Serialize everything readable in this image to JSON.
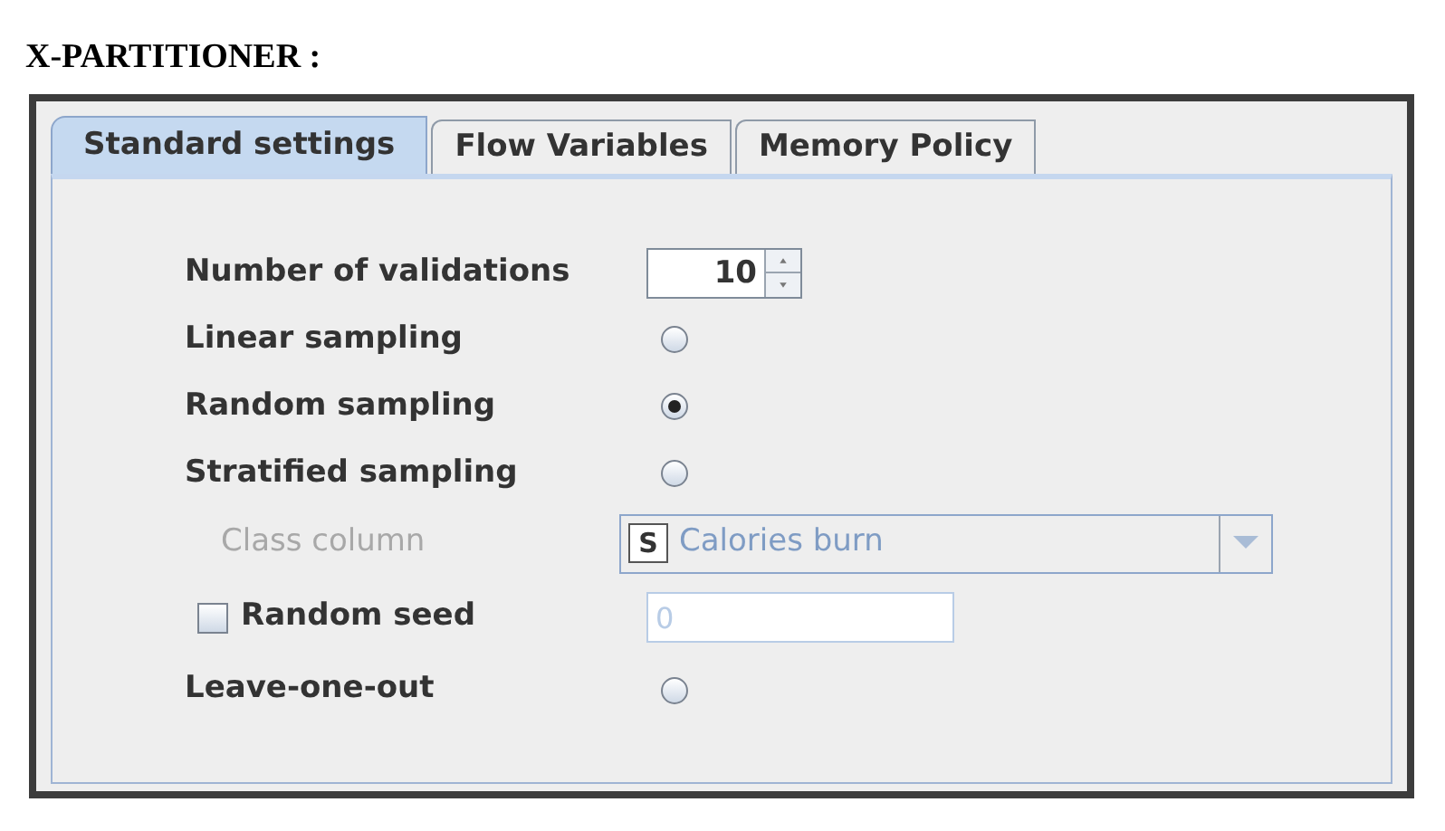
{
  "heading": "X-PARTITIONER :",
  "tabs": [
    {
      "label": "Standard settings",
      "selected": true
    },
    {
      "label": "Flow Variables",
      "selected": false
    },
    {
      "label": "Memory Policy",
      "selected": false
    }
  ],
  "rows": [
    {
      "kind": "spinner",
      "label": "Number of validations",
      "value": "10"
    },
    {
      "kind": "radio",
      "label": "Linear sampling",
      "selected": false
    },
    {
      "kind": "radio",
      "label": "Random sampling",
      "selected": true
    },
    {
      "kind": "radio",
      "label": "Stratified sampling",
      "selected": false
    },
    {
      "kind": "dropdown",
      "label": "Class column",
      "badge": "S",
      "value": "Calories burn",
      "disabled": true
    },
    {
      "kind": "checkbox_field",
      "label": "Random seed",
      "checked": false,
      "value": "0",
      "disabled": true
    },
    {
      "kind": "radio",
      "label": "Leave-one-out",
      "selected": false
    }
  ]
}
